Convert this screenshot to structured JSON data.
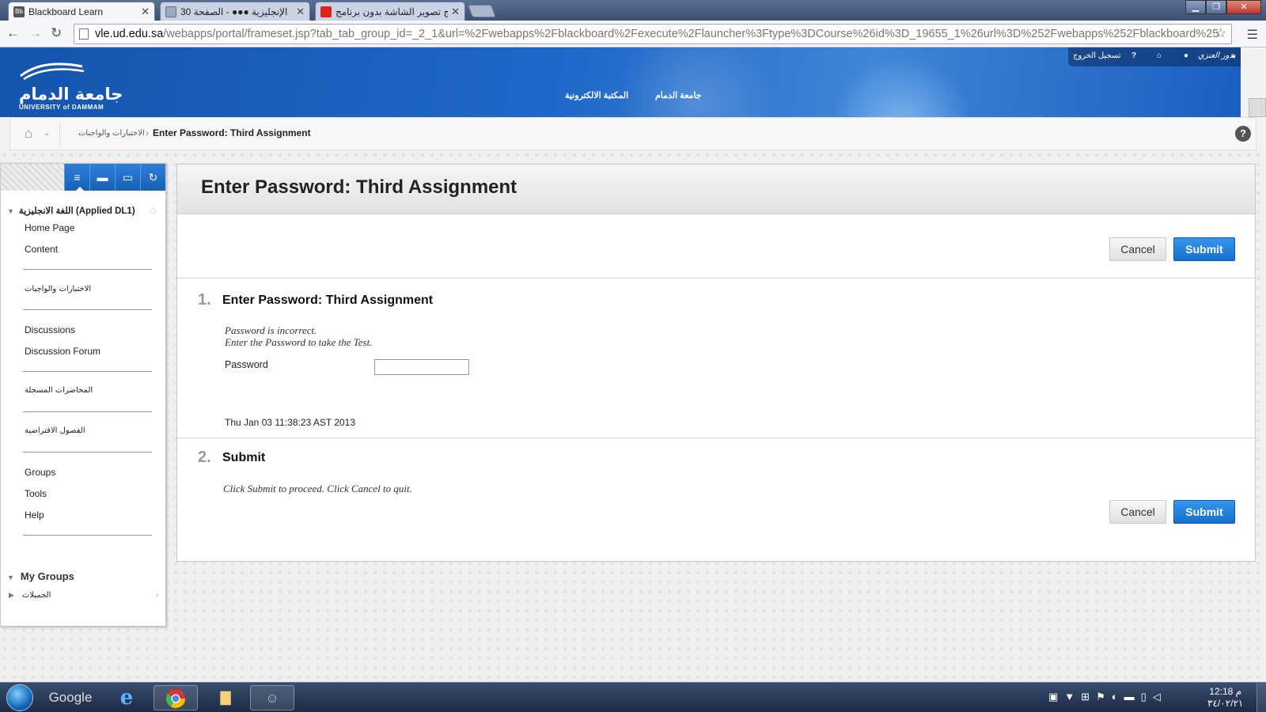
{
  "browser": {
    "tabs": [
      {
        "label": "Blackboard Learn",
        "favicon": "Bb",
        "active": true
      },
      {
        "label": "الإنجليزية ●●● - الصفحة 30",
        "active": false
      },
      {
        "label": "ج تصوير الشاشة بدون برنامج",
        "active": false
      }
    ],
    "close_glyph": "✕",
    "url_host": "vle.ud.edu.sa",
    "url_path": "/webapps/portal/frameset.jsp?tab_tab_group_id=_2_1&url=%2Fwebapps%2Fblackboard%2Fexecute%2Flauncher%3Ftype%3DCourse%26id%3D_19655_1%26url%3D%252Fwebapps%252Fblackboard%25"
  },
  "header": {
    "logo_ar": "جامعة الدمام",
    "logo_en": "UNIVERSITY of DAMMAM",
    "links": [
      "جامعة الدمام",
      "المكتبة الالكترونية"
    ],
    "user_name": "بدور العنزي",
    "logout": "تسجيل الخروج"
  },
  "breadcrumb": {
    "parent": "الاختبارات والواجبات",
    "current": "Enter Password: Third Assignment"
  },
  "left_menu": {
    "course": "اللغة الانجليزية (Applied DL1)",
    "items": [
      "Home Page",
      "Content",
      "الاختبارات والواجبات",
      "Discussions",
      "Discussion Forum",
      "المحاضرات المسجلة",
      "الفصول الافتراضية",
      "Groups",
      "Tools",
      "Help"
    ],
    "my_groups": "My Groups",
    "group_item": "الجميلات"
  },
  "main": {
    "title": "Enter Password: Third Assignment",
    "cancel_label": "Cancel",
    "submit_label": "Submit",
    "step1": {
      "num": "1.",
      "title": "Enter Password: Third Assignment",
      "msg1": "Password is incorrect.",
      "msg2": "Enter the Password to take the Test.",
      "password_label": "Password",
      "password_value": "",
      "timestamp": "Thu Jan 03 11:38:23 AST 2013"
    },
    "step2": {
      "num": "2.",
      "title": "Submit",
      "msg": "Click Submit to proceed. Click Cancel to quit."
    }
  },
  "taskbar": {
    "google_label": "Google",
    "clock_time": "12:18 م",
    "clock_date": "٣٤/٠٢/٢١"
  },
  "colors": {
    "brand_blue": "#1661b9",
    "submit_blue": "#146fd1"
  }
}
